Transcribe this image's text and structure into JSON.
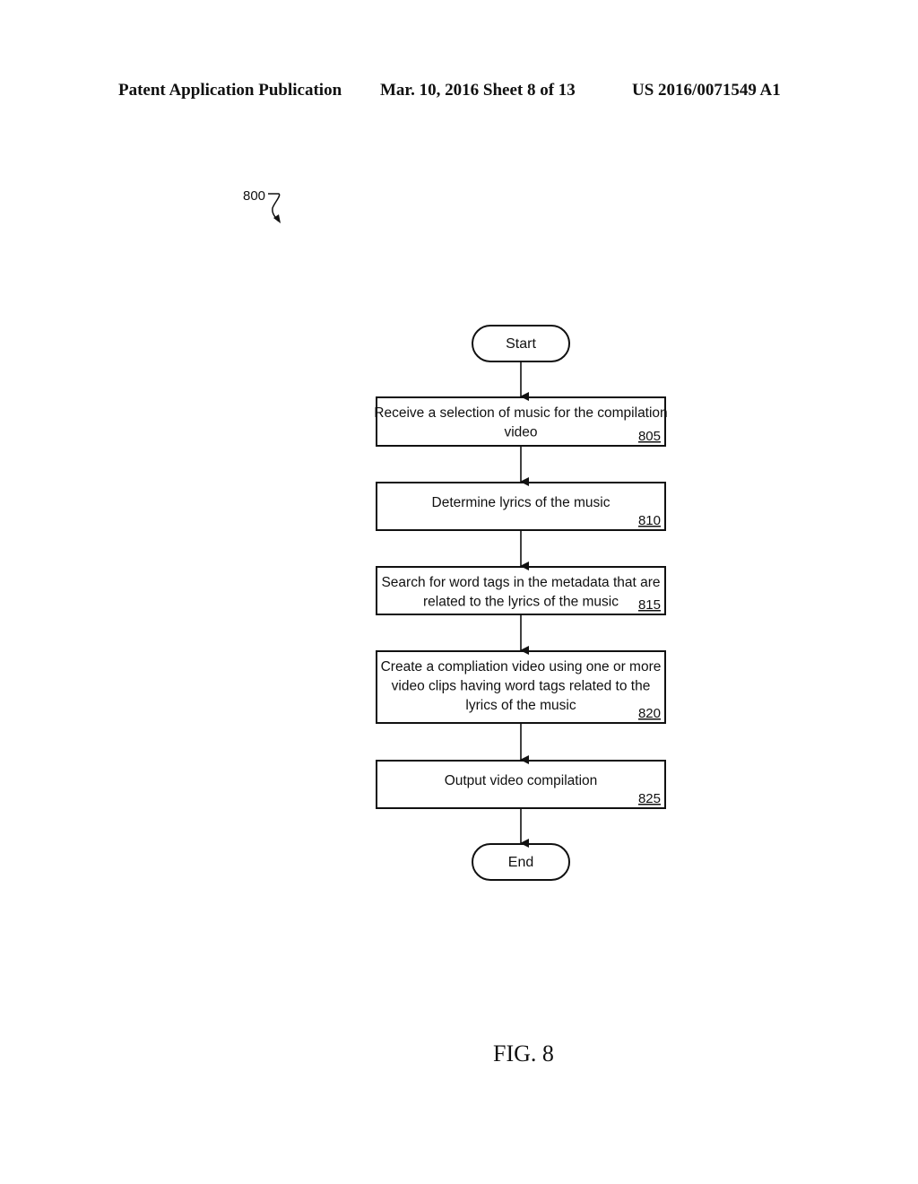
{
  "header": {
    "publication_type": "Patent Application Publication",
    "date_sheet": "Mar. 10, 2016  Sheet 8 of 13",
    "patent_number": "US 2016/0071549 A1"
  },
  "figure": {
    "reference": "800",
    "label": "FIG. 8"
  },
  "flowchart": {
    "start": "Start",
    "end": "End",
    "steps": [
      {
        "id": "805",
        "lines": [
          "Receive a selection of music for the compilation",
          "video"
        ]
      },
      {
        "id": "810",
        "lines": [
          "Determine lyrics of the music"
        ]
      },
      {
        "id": "815",
        "lines": [
          "Search for word tags in the metadata that are",
          "related to the lyrics of the music"
        ]
      },
      {
        "id": "820",
        "lines": [
          "Create a compliation video using one or more",
          "video clips having word tags related to the",
          "lyrics of the music"
        ]
      },
      {
        "id": "825",
        "lines": [
          "Output video compilation"
        ]
      }
    ]
  }
}
